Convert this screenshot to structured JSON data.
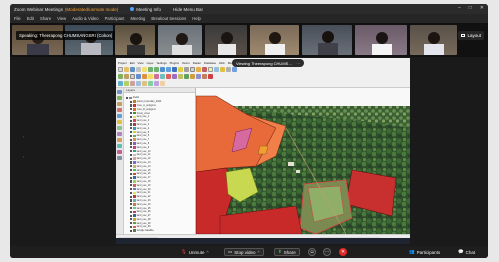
{
  "window": {
    "app_title": "Zoom Webinar Meetings",
    "mode_label": "(Moderated/unmute mode)",
    "meeting_info": "Meeting Info",
    "hide_menu_bar": "Hide Menu Bar",
    "controls": {
      "minimize": "–",
      "maximize": "□",
      "close": "✕"
    }
  },
  "menu": {
    "items": [
      "File",
      "Edit",
      "Share",
      "View",
      "Audio & Video",
      "Participant",
      "Meeting",
      "Breakout Sessions",
      "Help"
    ]
  },
  "speaking": {
    "label": "Speaking: Theerapong CHUMSANGSRI (Cokon)"
  },
  "layout": {
    "label": "Layout"
  },
  "share": {
    "viewing_label": "Viewing Theerapong CHUMS…",
    "qgis_menu": [
      "Project",
      "Edit",
      "View",
      "Layer",
      "Settings",
      "Plugins",
      "Vector",
      "Raster",
      "Database",
      "Web",
      "Mesh",
      "Processing",
      "Help"
    ],
    "panel_title": "Layers",
    "layers": [
      {
        "name": "Fields",
        "color": "#888888"
      },
      {
        "name": "parcel_boundary_2024",
        "color": "#c8782a"
      },
      {
        "name": "zone_A_polygons",
        "color": "#c83232"
      },
      {
        "name": "zone_B_polygons",
        "color": "#e06c1e"
      },
      {
        "name": "forest_cover",
        "color": "#4a8a3a"
      },
      {
        "name": "land_use_1",
        "color": "#d8e050"
      },
      {
        "name": "land_use_2",
        "color": "#c85050"
      },
      {
        "name": "land_use_3",
        "color": "#a04040"
      },
      {
        "name": "land_use_4",
        "color": "#30a0c0"
      },
      {
        "name": "land_use_5",
        "color": "#d0d040"
      },
      {
        "name": "land_use_6",
        "color": "#60b060"
      },
      {
        "name": "land_use_7",
        "color": "#e09040"
      },
      {
        "name": "land_use_8",
        "color": "#9060b0"
      },
      {
        "name": "land_use_9",
        "color": "#d04080"
      },
      {
        "name": "land_use_10",
        "color": "#40a080"
      },
      {
        "name": "land_use_11",
        "color": "#c0c0c0"
      },
      {
        "name": "land_use_12",
        "color": "#e0a0a0"
      },
      {
        "name": "land_use_13",
        "color": "#7070d0"
      },
      {
        "name": "land_use_14",
        "color": "#d0b070"
      },
      {
        "name": "land_use_15",
        "color": "#50c050"
      },
      {
        "name": "land_use_16",
        "color": "#c05030"
      },
      {
        "name": "land_use_17",
        "color": "#3070a0"
      },
      {
        "name": "land_use_18",
        "color": "#a0d060"
      },
      {
        "name": "land_use_19",
        "color": "#d06060"
      },
      {
        "name": "land_use_20",
        "color": "#6080c0"
      },
      {
        "name": "land_use_21",
        "color": "#e0e060"
      },
      {
        "name": "land_use_22",
        "color": "#b04040"
      },
      {
        "name": "land_use_23",
        "color": "#70b0b0"
      },
      {
        "name": "land_use_24",
        "color": "#c08040"
      },
      {
        "name": "land_use_25",
        "color": "#80c080"
      },
      {
        "name": "land_use_26",
        "color": "#c04060"
      },
      {
        "name": "land_use_27",
        "color": "#4060a0"
      },
      {
        "name": "land_use_28",
        "color": "#d0a030"
      },
      {
        "name": "land_use_29",
        "color": "#60a040"
      },
      {
        "name": "land_use_30",
        "color": "#e06040"
      },
      {
        "name": "Google Satellite",
        "color": "#5a7a4a"
      }
    ]
  },
  "controls": {
    "unmute": "Unmute",
    "stop_video": "Stop video",
    "share": "Share",
    "participants": "Participants",
    "chat": "Chat"
  },
  "colors": {
    "moderated": "#f0a030",
    "end_button": "#e02828",
    "meeting_info_dot": "#4da3ff"
  }
}
